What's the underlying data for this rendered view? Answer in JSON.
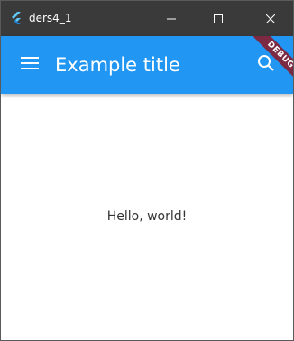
{
  "window": {
    "title": "ders4_1",
    "icon": "flutter-logo-icon",
    "controls": {
      "minimize_icon": "minimize-icon",
      "maximize_icon": "maximize-icon",
      "close_icon": "close-icon"
    }
  },
  "appbar": {
    "title": "Example title",
    "menu_icon": "menu-icon",
    "action_icon": "search-icon",
    "color": "#2196f3"
  },
  "debug_banner": {
    "label": "DEBUG"
  },
  "body": {
    "text": "Hello, world!"
  }
}
